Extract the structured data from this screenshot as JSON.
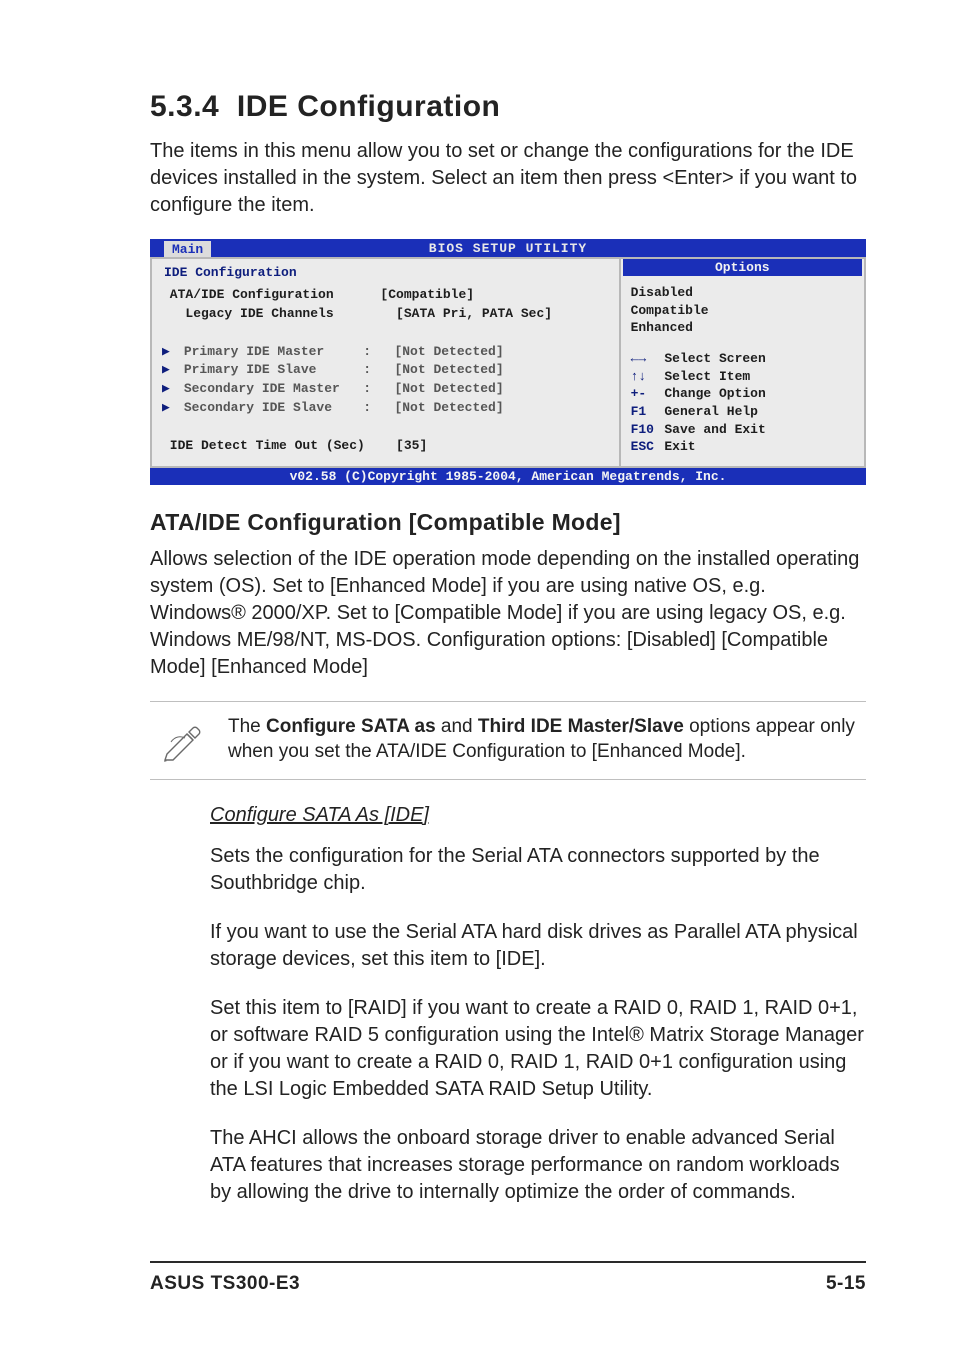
{
  "section": {
    "number": "5.3.4",
    "title": "IDE Configuration"
  },
  "intro": "The items in this menu allow you to set or change the configurations for the IDE devices installed in the system. Select an item then press <Enter> if you want to configure the item.",
  "bios": {
    "title": "BIOS SETUP UTILITY",
    "tab": "Main",
    "panel_title": "IDE Configuration",
    "settings": [
      {
        "label": "ATA/IDE Configuration",
        "value": "[Compatible]",
        "colon": "",
        "indent": "",
        "tri": false,
        "grey": false
      },
      {
        "label": "Legacy IDE Channels",
        "value": "[SATA Pri, PATA Sec]",
        "colon": "",
        "indent": "  ",
        "tri": false,
        "grey": false
      },
      {
        "label": "",
        "value": "",
        "colon": "",
        "indent": "",
        "tri": false,
        "grey": false
      },
      {
        "label": "Primary IDE Master",
        "value": "[Not Detected]",
        "colon": ":  ",
        "indent": " ",
        "tri": true,
        "grey": true
      },
      {
        "label": "Primary IDE Slave",
        "value": "[Not Detected]",
        "colon": ":  ",
        "indent": " ",
        "tri": true,
        "grey": true
      },
      {
        "label": "Secondary IDE Master",
        "value": "[Not Detected]",
        "colon": ":  ",
        "indent": " ",
        "tri": true,
        "grey": true
      },
      {
        "label": "Secondary IDE Slave",
        "value": "[Not Detected]",
        "colon": ":  ",
        "indent": " ",
        "tri": true,
        "grey": true
      },
      {
        "label": "",
        "value": "",
        "colon": "",
        "indent": "",
        "tri": false,
        "grey": false
      },
      {
        "label": "IDE Detect Time Out (Sec)",
        "value": "[35]",
        "colon": "",
        "indent": "",
        "tri": false,
        "grey": false
      }
    ],
    "options_title": "Options",
    "options": [
      "Disabled",
      "Compatible",
      "Enhanced"
    ],
    "help": [
      {
        "glyph": "←→",
        "text": "Select Screen"
      },
      {
        "glyph": "↑↓",
        "text": "Select Item"
      },
      {
        "glyph": "+-",
        "text": "Change Option"
      },
      {
        "glyph": "F1",
        "text": "General Help"
      },
      {
        "glyph": "F10",
        "text": "Save and Exit"
      },
      {
        "glyph": "ESC",
        "text": "Exit"
      }
    ],
    "footer": "v02.58 (C)Copyright 1985-2004, American Megatrends, Inc."
  },
  "subheading": "ATA/IDE Configuration [Compatible Mode]",
  "subtext": "Allows selection of the IDE operation mode depending on the installed operating system (OS). Set to [Enhanced Mode] if you are using native OS, e.g. Windows® 2000/XP. Set to [Compatible Mode] if you are using legacy OS, e.g. Windows ME/98/NT, MS-DOS. Configuration options: [Disabled] [Compatible Mode] [Enhanced Mode]",
  "note": {
    "t1": "The ",
    "b1": "Configure SATA as",
    "t2": " and ",
    "b2": "Third IDE Master/Slave",
    "t3": " options appear only when you set the ATA/IDE Configuration to [Enhanced Mode]."
  },
  "sata": {
    "heading": "Configure SATA As [IDE]",
    "p1": "Sets the configuration for the Serial ATA connectors supported by the Southbridge chip.",
    "p2": "If you want to use the Serial ATA hard disk drives as Parallel ATA physical storage devices, set this item to [IDE].",
    "p3": "Set this item to [RAID] if you want to create a RAID 0, RAID 1, RAID 0+1, or software RAID 5 configuration using the Intel® Matrix Storage Manager or if you want to create a RAID 0, RAID 1, RAID 0+1 configuration using the LSI Logic Embedded SATA RAID Setup Utility.",
    "p4": "The AHCI allows the onboard storage driver to enable advanced Serial ATA features that increases storage performance on random workloads by allowing the drive to internally optimize the order of commands."
  },
  "footer": {
    "left": "ASUS TS300-E3",
    "right": "5-15"
  }
}
